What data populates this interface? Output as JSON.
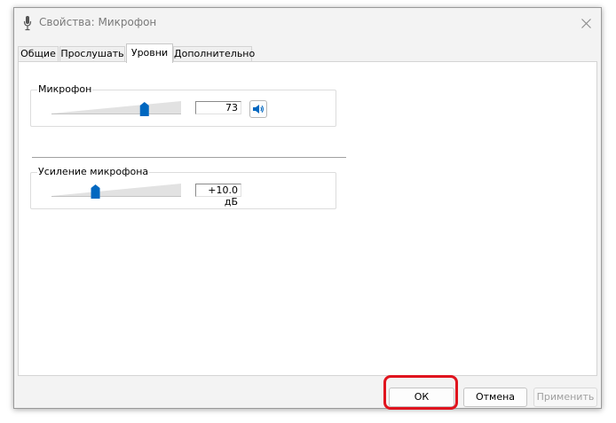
{
  "window": {
    "title": "Свойства: Микрофон"
  },
  "tabs": [
    {
      "label": "Общие"
    },
    {
      "label": "Прослушать"
    },
    {
      "label": "Уровни",
      "active": true
    },
    {
      "label": "Дополнительно"
    }
  ],
  "levels": {
    "microphone": {
      "label": "Микрофон",
      "value": "73",
      "level_fraction": 0.73
    },
    "boost": {
      "label": "Усиление микрофона",
      "value": "+10.0 дБ",
      "level_fraction": 0.33
    }
  },
  "buttons": {
    "ok": "ОК",
    "cancel": "Отмена",
    "apply": "Применить"
  },
  "colors": {
    "accent": "#0067c0",
    "highlight": "#e0141e"
  }
}
